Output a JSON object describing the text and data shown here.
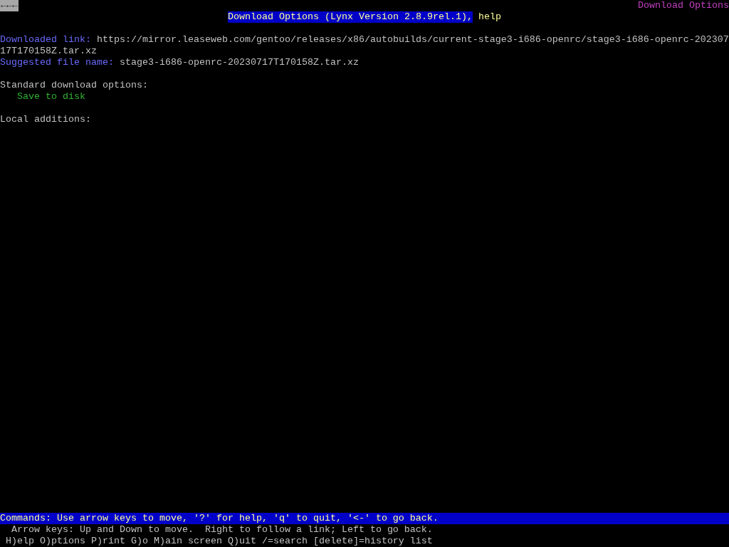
{
  "top_bar": {
    "back_indicator": "←←←",
    "page_title": "Download Options"
  },
  "title": {
    "text": "Download Options (Lynx Version 2.8.9rel.1),",
    "help_link": "help"
  },
  "fields": [
    {
      "label": "Downloaded link:",
      "value": "https://mirror.leaseweb.com/gentoo/releases/x86/autobuilds/current-stage3-i686-openrc/stage3-i686-openrc-20230717T170158Z.tar.xz"
    },
    {
      "label": "Suggested file name:",
      "value": "stage3-i686-openrc-20230717T170158Z.tar.xz"
    }
  ],
  "sections": [
    {
      "heading": "Standard download options:",
      "links": [
        "Save to disk"
      ]
    },
    {
      "heading": "Local additions:"
    }
  ],
  "status_bar": {
    "commands": "Commands: Use arrow keys to move, '?' for help, 'q' to quit, '<-' to go back.",
    "hint": "  Arrow keys: Up and Down to move.  Right to follow a link; Left to go back.",
    "keys": " H)elp O)ptions P)rint G)o M)ain screen Q)uit /=search [delete]=history list"
  }
}
